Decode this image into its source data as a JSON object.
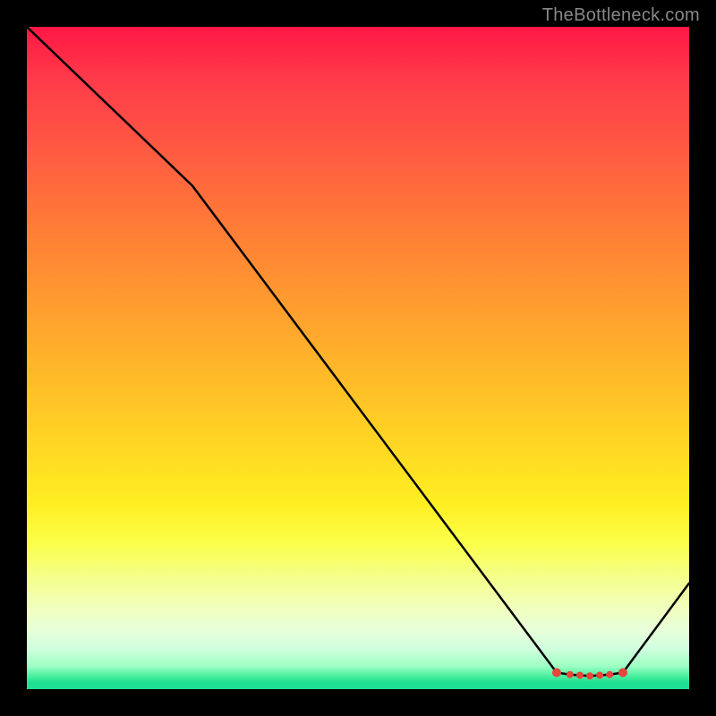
{
  "attribution": "TheBottleneck.com",
  "chart_data": {
    "type": "line",
    "title": "",
    "xlabel": "",
    "ylabel": "",
    "xlim": [
      0,
      100
    ],
    "ylim": [
      0,
      100
    ],
    "series": [
      {
        "name": "curve",
        "x": [
          0,
          25,
          80,
          82,
          83.5,
          85,
          86.5,
          88,
          90,
          100
        ],
        "values": [
          100,
          76,
          2.5,
          2.2,
          2.1,
          2.0,
          2.1,
          2.2,
          2.5,
          16
        ]
      }
    ],
    "markers": {
      "name": "minima",
      "color": "#e8453c",
      "x": [
        80,
        82,
        83.5,
        85,
        86.5,
        88,
        90
      ],
      "values": [
        2.5,
        2.2,
        2.1,
        2.0,
        2.1,
        2.2,
        2.5
      ]
    },
    "gradient_stops": [
      {
        "pos": 0.0,
        "color": "#ff1744"
      },
      {
        "pos": 0.5,
        "color": "#ffb726"
      },
      {
        "pos": 0.75,
        "color": "#fff92a"
      },
      {
        "pos": 0.9,
        "color": "#ecffc8"
      },
      {
        "pos": 1.0,
        "color": "#1ddf92"
      }
    ]
  }
}
